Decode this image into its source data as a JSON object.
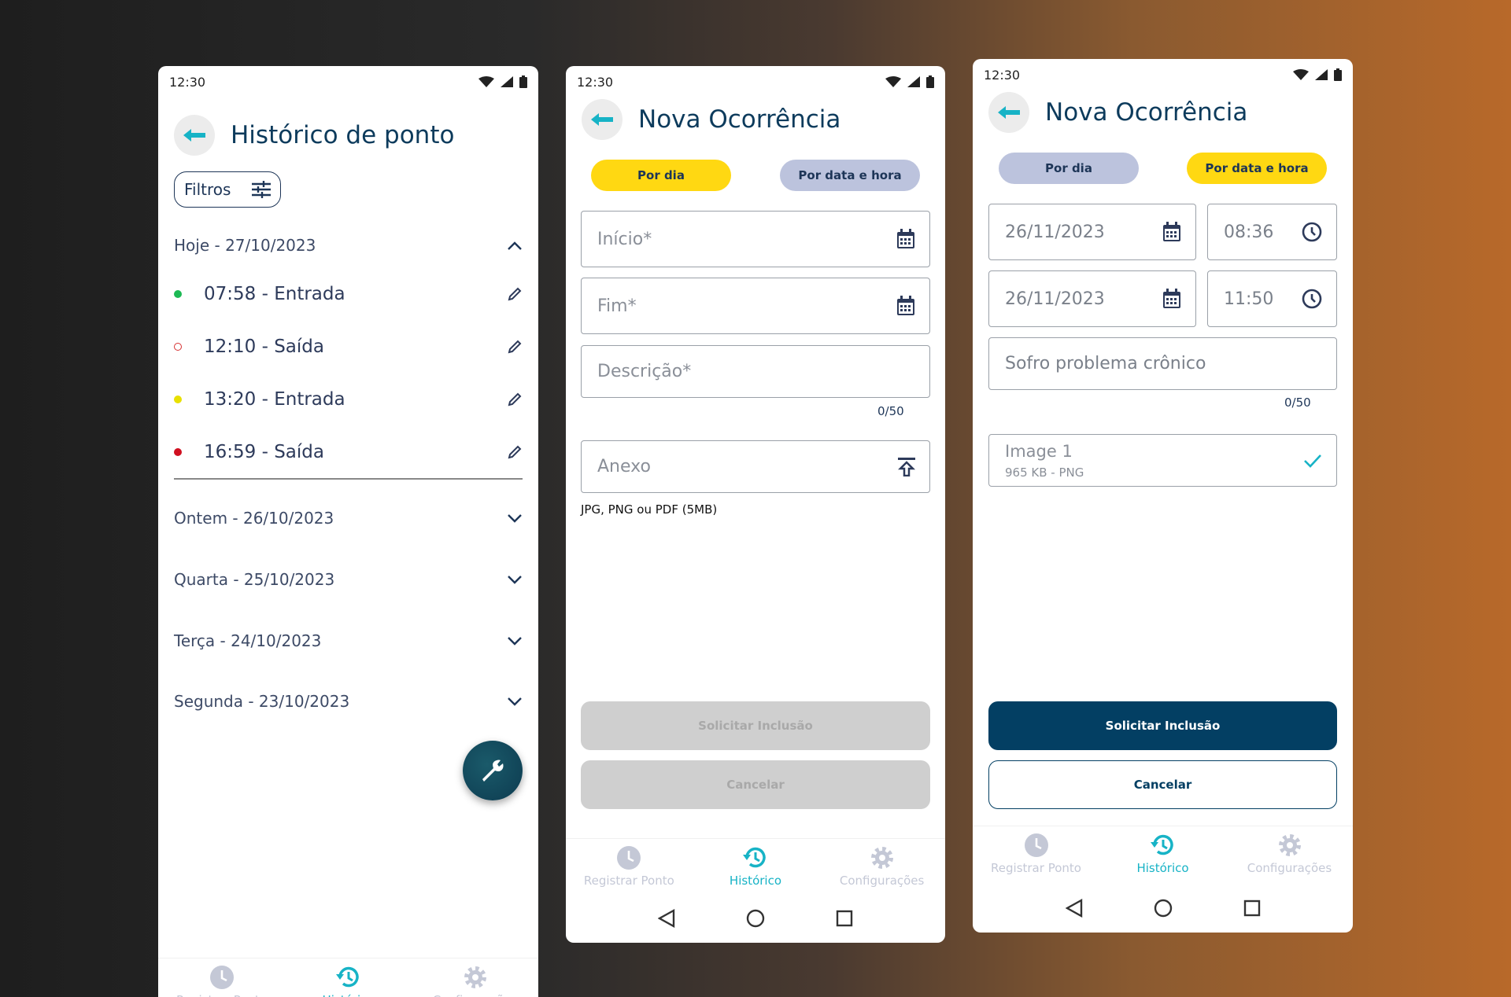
{
  "status": {
    "time": "12:30"
  },
  "screen1": {
    "title": "Histórico de ponto",
    "filters_label": "Filtros",
    "today_header": "Hoje - 27/10/2023",
    "entries": [
      {
        "text": "07:58 - Entrada",
        "color": "#1db954",
        "filled": true
      },
      {
        "text": "12:10 - Saída",
        "color": "#d63031",
        "filled": false
      },
      {
        "text": "13:20 - Entrada",
        "color": "#e8e000",
        "filled": true
      },
      {
        "text": "16:59 - Saída",
        "color": "#d01020",
        "filled": true
      }
    ],
    "other_days": [
      "Ontem - 26/10/2023",
      "Quarta - 25/10/2023",
      "Terça - 24/10/2023",
      "Segunda - 23/10/2023"
    ]
  },
  "screen2": {
    "title": "Nova Ocorrência",
    "toggle_day": "Por dia",
    "toggle_datetime": "Por data e hora",
    "start_placeholder": "Início*",
    "end_placeholder": "Fim*",
    "description_placeholder": "Descrição*",
    "counter": "0/50",
    "attachment_placeholder": "Anexo",
    "attachment_hint": "JPG, PNG ou PDF (5MB)",
    "submit_label": "Solicitar Inclusão",
    "cancel_label": "Cancelar"
  },
  "screen3": {
    "title": "Nova Ocorrência",
    "toggle_day": "Por dia",
    "toggle_datetime": "Por data e hora",
    "start_date": "26/11/2023",
    "start_time": "08:36",
    "end_date": "26/11/2023",
    "end_time": "11:50",
    "description": "Sofro problema crônico",
    "counter": "0/50",
    "attachment_name": "Image 1",
    "attachment_meta": "965 KB - PNG",
    "submit_label": "Solicitar Inclusão",
    "cancel_label": "Cancelar"
  },
  "nav": {
    "register": "Registrar Ponto",
    "history": "Histórico",
    "settings": "Configurações"
  },
  "colors": {
    "accent": "#17b3c6",
    "primary": "#033f63",
    "yellow": "#ffd812",
    "inactive_toggle": "#bcc3dd"
  }
}
